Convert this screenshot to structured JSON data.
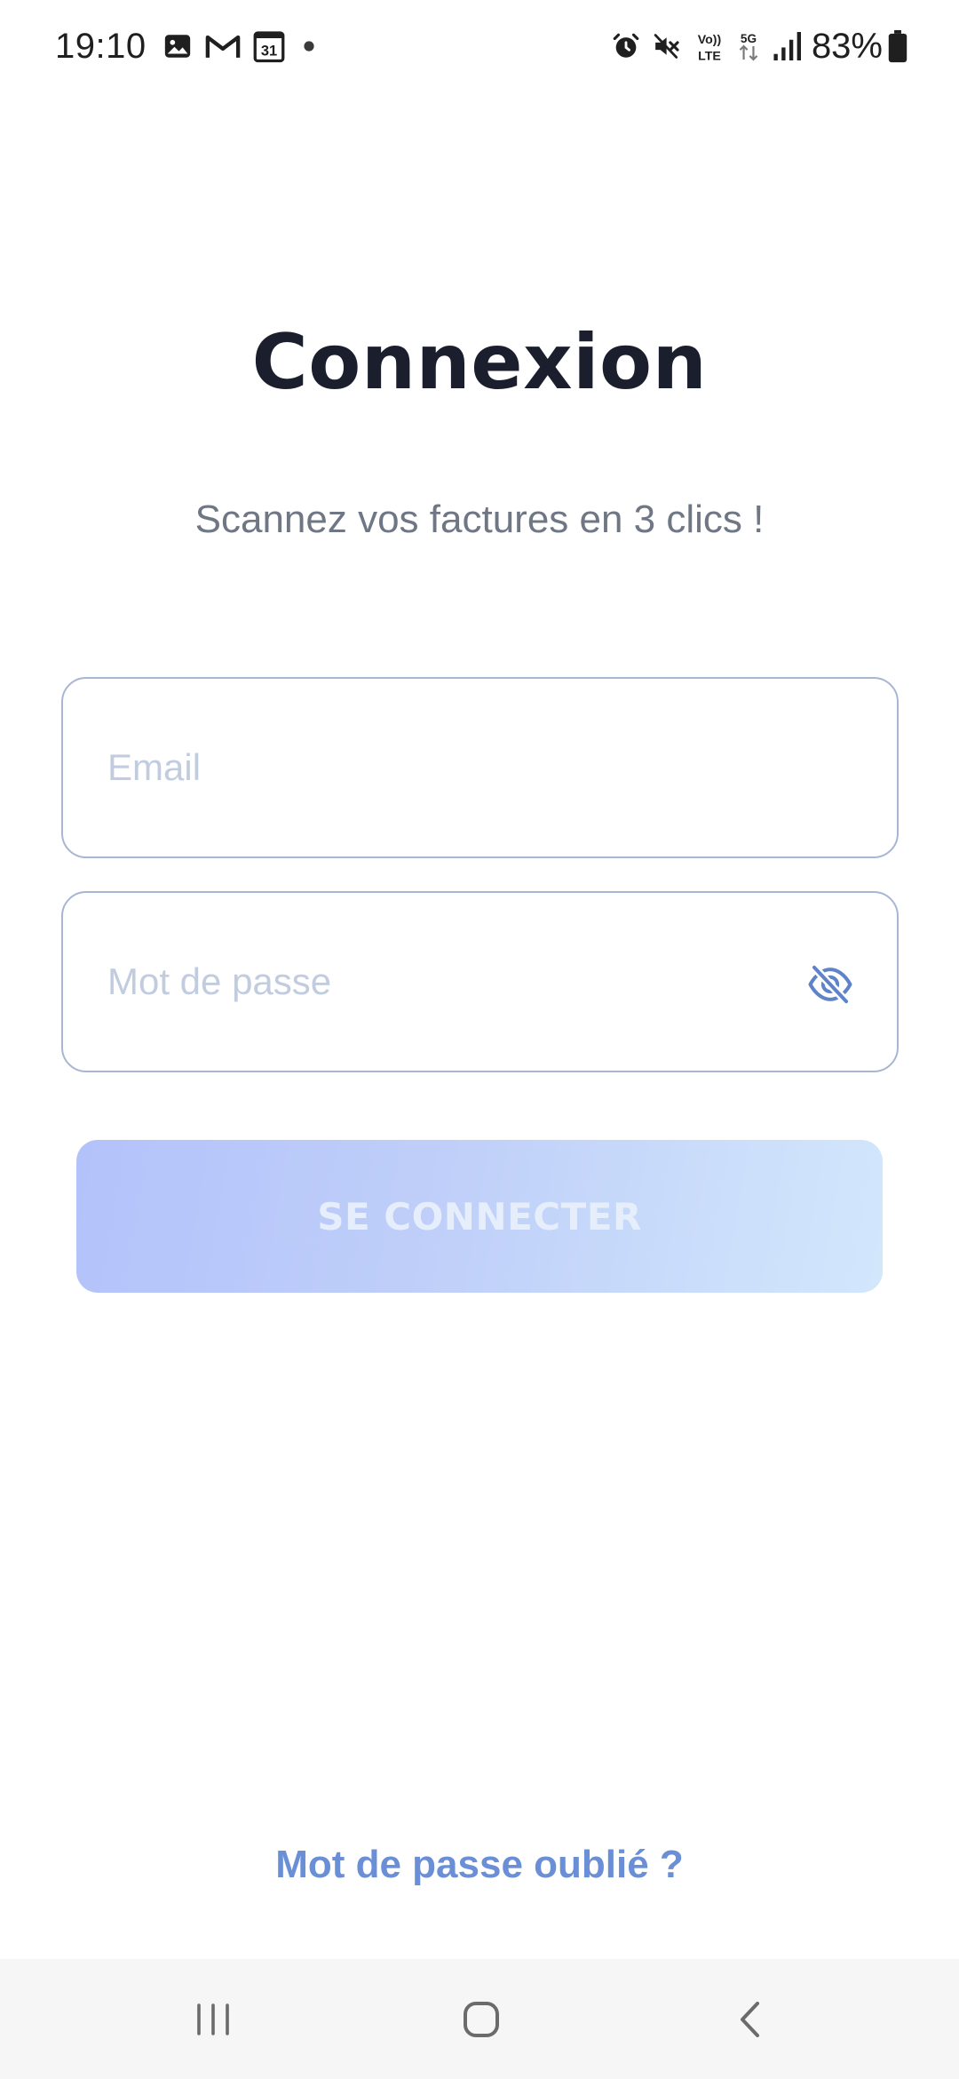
{
  "status_bar": {
    "time": "19:10",
    "left_icons": [
      "gallery-icon",
      "gmail-icon",
      "calendar-icon",
      "notification-dot-icon"
    ],
    "calendar_day": "31",
    "right_icons": [
      "alarm-icon",
      "mute-icon",
      "volte-icon",
      "5g-icon",
      "signal-icon",
      "battery-icon"
    ],
    "volte_label": "Vo)) LTE",
    "network_label": "5G",
    "battery": "83%"
  },
  "login": {
    "title": "Connexion",
    "subtitle": "Scannez vos factures en 3 clics !",
    "email_placeholder": "Email",
    "email_value": "",
    "password_placeholder": "Mot de passe",
    "password_value": "",
    "password_visibility_icon": "eye-off-icon",
    "submit_label": "SE CONNECTER",
    "forgot_password_label": "Mot de passe oublié ?"
  },
  "colors": {
    "title": "#1b1e2d",
    "subtitle": "#6f7785",
    "field_border": "#a8b6d3",
    "placeholder": "#c2ccdf",
    "accent": "#6a8fd6",
    "button_gradient_start": "#b3c2fa",
    "button_gradient_end": "#d2e7fc",
    "button_text": "#e6eefc",
    "nav_background": "#f6f6f6"
  },
  "nav_bar": {
    "buttons": [
      "recents-icon",
      "home-icon",
      "back-icon"
    ]
  }
}
